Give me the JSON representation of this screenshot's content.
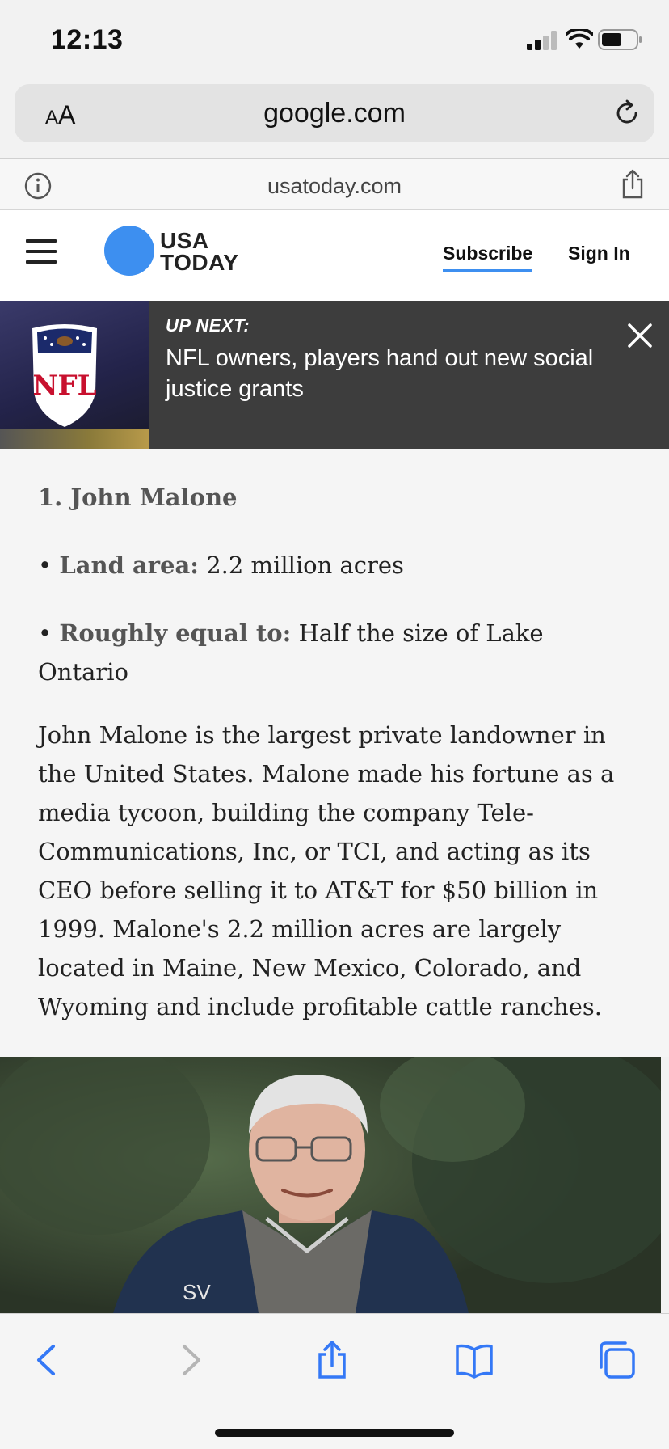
{
  "status_bar": {
    "time": "12:13"
  },
  "browser": {
    "text_size_label_small": "A",
    "text_size_label_large": "A",
    "url": "google.com",
    "site_domain": "usatoday.com"
  },
  "site_header": {
    "logo_line1": "USA",
    "logo_line2": "TODAY",
    "subscribe": "Subscribe",
    "sign_in": "Sign In",
    "accent_color": "#3d8ff0"
  },
  "up_next": {
    "label": "UP NEXT:",
    "title": "NFL owners, players hand out new social justice grants",
    "thumbnail_logo": "NFL"
  },
  "article": {
    "heading": "1. John Malone",
    "land_area_label": "Land area:",
    "land_area_value": "2.2 million acres",
    "equal_label": "Roughly equal to:",
    "equal_value": "Half the size of Lake Ontario",
    "body": "John Malone is the largest private landowner in the United States. Malone made his fortune as a media tycoon, building the company Tele-Communications, Inc, or TCI, and acting as its CEO before selling it to AT&T for $50 billion in 1999. Malone's 2.2 million acres are largely located in Maine, New Mexico, Colorado, and Wyoming and include profitable cattle ranches."
  },
  "photo": {
    "shirt_text": "SV"
  },
  "toolbar": {
    "icons": [
      "back-icon",
      "forward-icon",
      "share-icon",
      "bookmarks-icon",
      "tabs-icon"
    ]
  }
}
